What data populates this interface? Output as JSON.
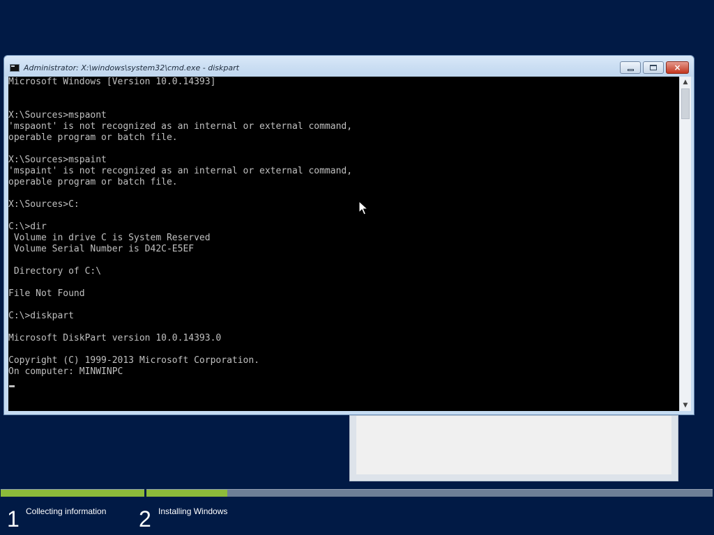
{
  "window": {
    "title": "Administrator: X:\\windows\\system32\\cmd.exe - diskpart",
    "icon": "console-icon",
    "controls": {
      "minimize": "minimize-icon",
      "maximize": "maximize-icon",
      "close": "×"
    }
  },
  "console": {
    "lines": [
      "Microsoft Windows [Version 10.0.14393]",
      "",
      "",
      "X:\\Sources>mspaont",
      "'mspaont' is not recognized as an internal or external command,",
      "operable program or batch file.",
      "",
      "X:\\Sources>mspaint",
      "'mspaint' is not recognized as an internal or external command,",
      "operable program or batch file.",
      "",
      "X:\\Sources>C:",
      "",
      "C:\\>dir",
      " Volume in drive C is System Reserved",
      " Volume Serial Number is D42C-E5EF",
      "",
      " Directory of C:\\",
      "",
      "File Not Found",
      "",
      "C:\\>diskpart",
      "",
      "Microsoft DiskPart version 10.0.14393.0",
      "",
      "Copyright (C) 1999-2013 Microsoft Corporation.",
      "On computer: MINWINPC"
    ]
  },
  "scrollbar": {
    "up_arrow": "▲",
    "down_arrow": "▼"
  },
  "setup": {
    "steps": [
      {
        "number": "1",
        "label": "Collecting information",
        "progress": 1.0
      },
      {
        "number": "2",
        "label": "Installing Windows",
        "progress": 0.143
      }
    ]
  },
  "colors": {
    "desktop": "#011a45",
    "console_bg": "#000000",
    "console_text": "#c0c0c0",
    "progress_fill": "#8dbb3a",
    "progress_track": "#6e7f96"
  }
}
